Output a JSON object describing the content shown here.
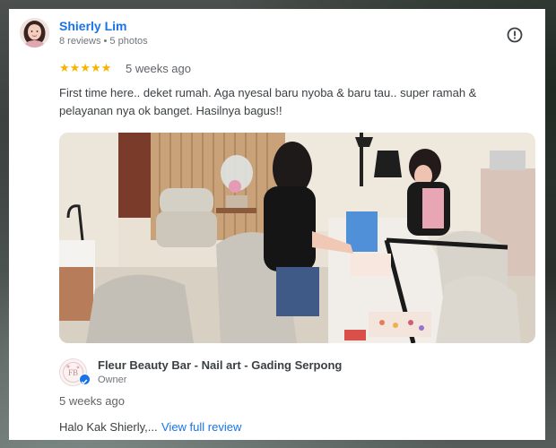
{
  "reviewer": {
    "name": "Shierly Lim",
    "meta": "8 reviews • 5 photos"
  },
  "review": {
    "stars": "★★★★★",
    "rating": 5,
    "date": "5 weeks ago",
    "text": "First time here.. deket rumah. Aga nyesal baru nyoba & baru tau.. super ramah & pelayanan nya ok banget. Hasilnya bagus!!"
  },
  "owner": {
    "name": "Fleur Beauty Bar - Nail art - Gading Serpong",
    "role": "Owner",
    "logo_text": "FB",
    "response_date": "5 weeks ago",
    "response_text": "Halo Kak Shierly,...",
    "view_link": "View full review"
  },
  "icons": {
    "more": "alert-circle-icon",
    "verified": "check-badge-icon"
  },
  "colors": {
    "link": "#1a73e8",
    "star": "#f6b400"
  }
}
